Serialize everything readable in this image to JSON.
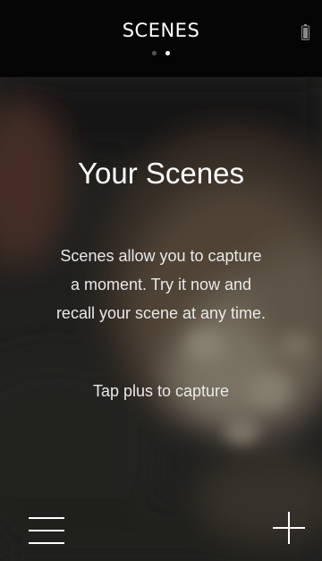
{
  "header": {
    "title": "SCENES",
    "pages": {
      "count": 2,
      "active": 2
    }
  },
  "main": {
    "heading": "Your Scenes",
    "description_lines": [
      "Scenes allow you to capture",
      "a moment. Try it now and",
      "recall your scene at any time."
    ],
    "hint": "Tap plus to capture"
  },
  "icons": {
    "status": "battery-icon",
    "menu": "hamburger-menu-icon",
    "add": "plus-icon"
  },
  "colors": {
    "header_bg": "#050505",
    "text": "#ffffff",
    "muted_text": "#e9e9e9"
  }
}
